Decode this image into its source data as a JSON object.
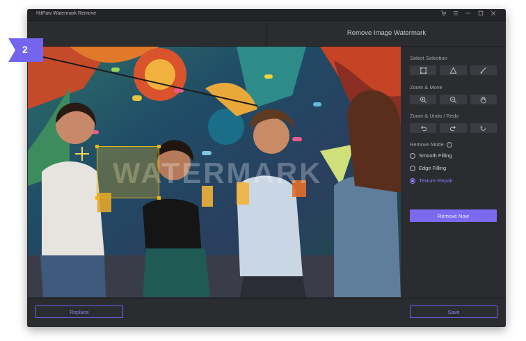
{
  "app": {
    "title": "HitPaw Watermark Remove",
    "header_title": "Remove Image Watermark",
    "step_number": "2"
  },
  "canvas": {
    "watermark_text": "WATERMARK"
  },
  "panel": {
    "select_selection_label": "Select Selection",
    "zoom_move_label": "Zoom & Move",
    "zoom_undo_redo_label": "Zoom & Undo / Redo",
    "remove_mode_label": "Remove Mode",
    "modes": [
      {
        "label": "Smooth Filling",
        "selected": false
      },
      {
        "label": "Edge Filling",
        "selected": false
      },
      {
        "label": "Texture Repair",
        "selected": true
      }
    ],
    "remove_now_label": "Remove Now"
  },
  "footer": {
    "replace_label": "Replace",
    "save_label": "Save"
  },
  "colors": {
    "accent": "#7b69f0",
    "selection": "#e3b21d",
    "window_bg": "#2b2c30"
  },
  "icons": [
    "cart-icon",
    "menu-icon",
    "minimize-icon",
    "maximize-icon",
    "close-icon",
    "rectangle-select-icon",
    "lasso-select-icon",
    "brush-icon",
    "zoom-in-icon",
    "zoom-out-icon",
    "hand-icon",
    "undo-icon",
    "redo-icon",
    "reset-icon"
  ]
}
